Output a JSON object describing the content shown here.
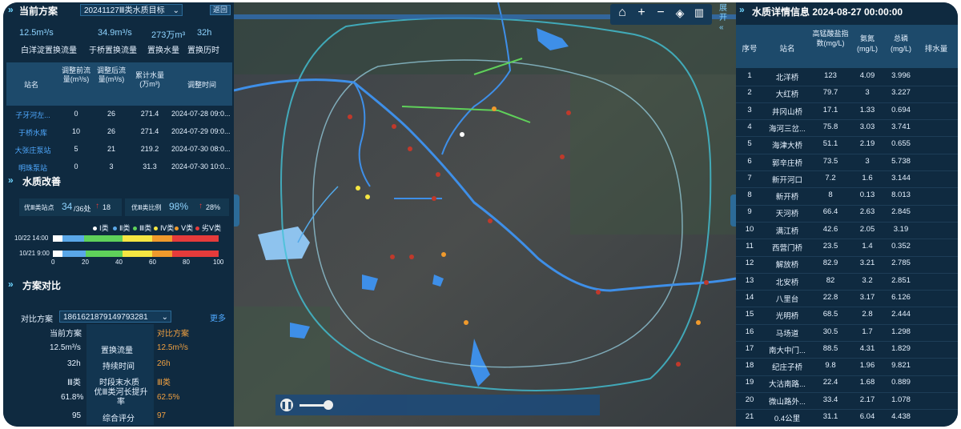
{
  "left": {
    "current_plan_title": "当前方案",
    "plan_select": "20241127Ⅲ类水质目标",
    "back_button": "返回",
    "metrics": [
      {
        "value": "12.5m³/s",
        "label": "白洋淀置换流量"
      },
      {
        "value": "34.9m³/s",
        "label": "于桥置换流量"
      },
      {
        "value": "273万m³",
        "label": "置换水量"
      },
      {
        "value": "32h",
        "label": "置换历时"
      }
    ],
    "station_table": {
      "headers": [
        "站名",
        "调整前流量(m³/s)",
        "调整后流量(m³/s)",
        "累计水量(万m³)",
        "调整时间"
      ],
      "rows": [
        [
          "子牙河左...",
          "0",
          "26",
          "271.4",
          "2024-07-28 09:0..."
        ],
        [
          "于桥水库",
          "10",
          "26",
          "271.4",
          "2024-07-29 09:0..."
        ],
        [
          "大张庄泵站",
          "5",
          "21",
          "219.2",
          "2024-07-30 08:0..."
        ],
        [
          "明珠泵站",
          "0",
          "3",
          "31.3",
          "2024-07-30 10:0..."
        ]
      ]
    },
    "quality_title": "水质改善",
    "quality_stats": {
      "good_sites_label": "优Ⅲ类站点",
      "good_sites_value": "34",
      "good_sites_total": "/36处",
      "good_sites_change": "18",
      "good_ratio_label": "优Ⅲ类比例",
      "good_ratio_value": "98%",
      "good_ratio_change": "28%"
    },
    "legend": [
      {
        "label": "Ⅰ类",
        "color": "#ffffff"
      },
      {
        "label": "Ⅱ类",
        "color": "#5aa7e8"
      },
      {
        "label": "Ⅲ类",
        "color": "#5fd15a"
      },
      {
        "label": "Ⅳ类",
        "color": "#f5e642"
      },
      {
        "label": "Ⅴ类",
        "color": "#f09a2c"
      },
      {
        "label": "劣Ⅴ类",
        "color": "#e53b3b"
      }
    ],
    "bars": [
      {
        "label": "10/22 14:00",
        "segments": [
          {
            "frac": 0.06,
            "color": "#ffffff"
          },
          {
            "frac": 0.13,
            "color": "#5aa7e8"
          },
          {
            "frac": 0.23,
            "color": "#5fd15a"
          },
          {
            "frac": 0.18,
            "color": "#f5e642"
          },
          {
            "frac": 0.12,
            "color": "#f09a2c"
          },
          {
            "frac": 0.28,
            "color": "#e53b3b"
          }
        ]
      },
      {
        "label": "10/21 9:00",
        "segments": [
          {
            "frac": 0.06,
            "color": "#ffffff"
          },
          {
            "frac": 0.14,
            "color": "#5aa7e8"
          },
          {
            "frac": 0.22,
            "color": "#5fd15a"
          },
          {
            "frac": 0.18,
            "color": "#f5e642"
          },
          {
            "frac": 0.12,
            "color": "#f09a2c"
          },
          {
            "frac": 0.28,
            "color": "#e53b3b"
          }
        ]
      }
    ],
    "axis_ticks": [
      "0",
      "20",
      "40",
      "60",
      "80",
      "100"
    ],
    "compare_title": "方案对比",
    "compare_select_label": "对比方案",
    "compare_select_value": "1861621879149793281",
    "more_link": "更多",
    "compare_header": {
      "left": "当前方案",
      "right": "对比方案"
    },
    "compare_rows": [
      {
        "left": "12.5m³/s",
        "mid": "置换流量",
        "right": "12.5m³/s"
      },
      {
        "left": "32h",
        "mid": "持续时间",
        "right": "26h"
      },
      {
        "left": "Ⅲ类",
        "mid": "时段末水质",
        "right": "Ⅲ类"
      },
      {
        "left": "61.8%",
        "mid": "优Ⅲ类河长提升率",
        "right": "62.5%"
      },
      {
        "left": "95",
        "mid": "综合评分",
        "right": "97"
      }
    ]
  },
  "map": {
    "expand_label": "展开",
    "controls": [
      "home-icon",
      "plus-icon",
      "minus-icon",
      "layers-icon",
      "map-icon"
    ]
  },
  "right": {
    "title": "水质详情信息 2024-08-27 00:00:00",
    "headers": [
      "序号",
      "站名",
      "高锰酸盐指数(mg/L)",
      "氨氮(mg/L)",
      "总磷(mg/L)",
      "排水量"
    ],
    "rows": [
      [
        "1",
        "北洋桥",
        "123",
        "4.09",
        "3.996"
      ],
      [
        "2",
        "大红桥",
        "79.7",
        "3",
        "3.227"
      ],
      [
        "3",
        "井冈山桥",
        "17.1",
        "1.33",
        "0.694"
      ],
      [
        "4",
        "海河三岔...",
        "75.8",
        "3.03",
        "3.741"
      ],
      [
        "5",
        "海津大桥",
        "51.1",
        "2.19",
        "0.655"
      ],
      [
        "6",
        "郭辛庄桥",
        "73.5",
        "3",
        "5.738"
      ],
      [
        "7",
        "新开河口",
        "7.2",
        "1.6",
        "3.144"
      ],
      [
        "8",
        "新开桥",
        "8",
        "0.13",
        "8.013"
      ],
      [
        "9",
        "天河桥",
        "66.4",
        "2.63",
        "2.845"
      ],
      [
        "10",
        "满江桥",
        "42.6",
        "2.05",
        "3.19"
      ],
      [
        "11",
        "西营门桥",
        "23.5",
        "1.4",
        "0.352"
      ],
      [
        "12",
        "解放桥",
        "82.9",
        "3.21",
        "2.785"
      ],
      [
        "13",
        "北安桥",
        "82",
        "3.2",
        "2.851"
      ],
      [
        "14",
        "八里台",
        "22.8",
        "3.17",
        "6.126"
      ],
      [
        "15",
        "光明桥",
        "68.5",
        "2.8",
        "2.444"
      ],
      [
        "16",
        "马场道",
        "30.5",
        "1.7",
        "1.298"
      ],
      [
        "17",
        "南大中门...",
        "88.5",
        "4.31",
        "1.829"
      ],
      [
        "18",
        "纪庄子桥",
        "9.8",
        "1.96",
        "9.821"
      ],
      [
        "19",
        "大沽南路...",
        "22.4",
        "1.68",
        "0.889"
      ],
      [
        "20",
        "微山路外...",
        "33.4",
        "2.17",
        "1.078"
      ],
      [
        "21",
        "0.4公里",
        "31.1",
        "6.04",
        "4.438"
      ]
    ]
  }
}
